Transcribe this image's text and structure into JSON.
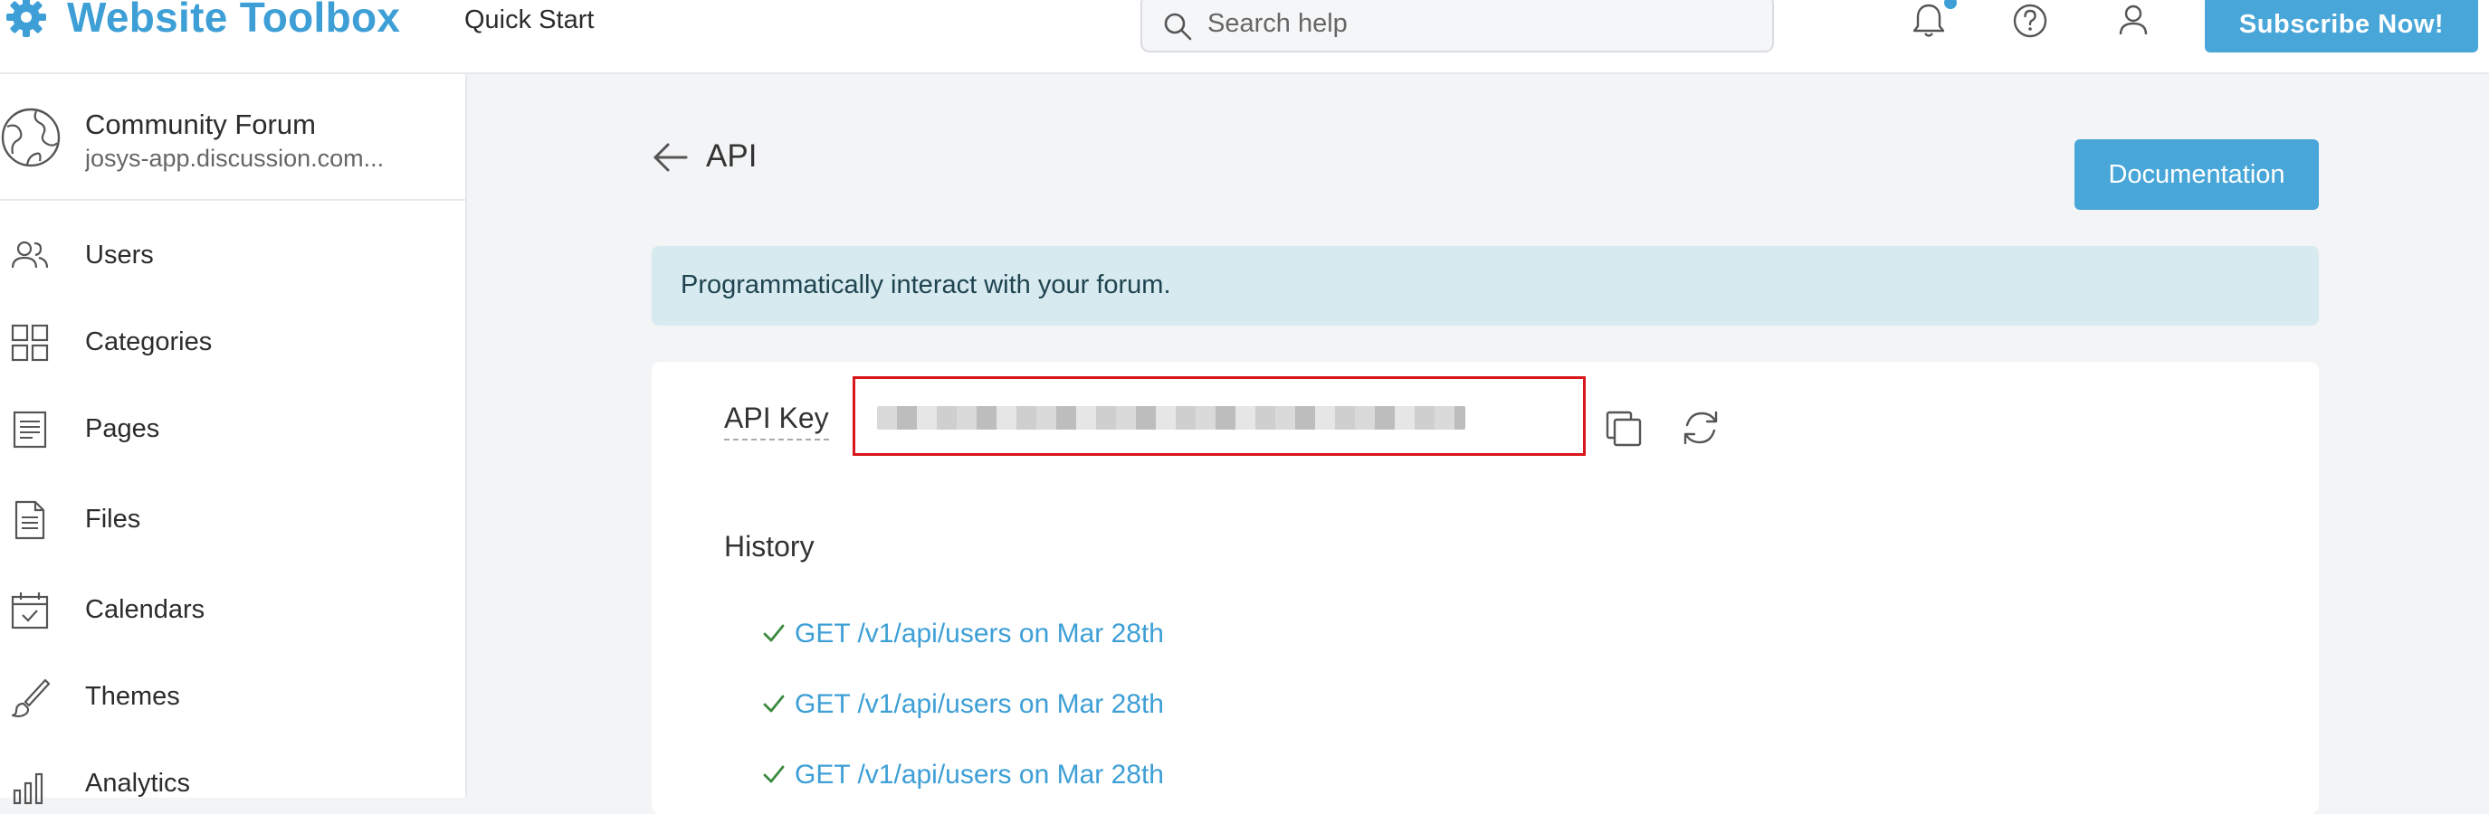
{
  "header": {
    "logo_text": "Website Toolbox",
    "quick_start": "Quick Start",
    "search_placeholder": "Search help",
    "subscribe_label": "Subscribe Now!"
  },
  "sidebar": {
    "site_name": "Community Forum",
    "site_url": "josys-app.discussion.com...",
    "items": [
      {
        "label": "Users",
        "icon": "users-icon"
      },
      {
        "label": "Categories",
        "icon": "categories-icon"
      },
      {
        "label": "Pages",
        "icon": "pages-icon"
      },
      {
        "label": "Files",
        "icon": "files-icon"
      },
      {
        "label": "Calendars",
        "icon": "calendar-icon"
      },
      {
        "label": "Themes",
        "icon": "brush-icon"
      },
      {
        "label": "Analytics",
        "icon": "analytics-icon"
      }
    ]
  },
  "main": {
    "title": "API",
    "documentation_label": "Documentation",
    "info_text": "Programmatically interact with your forum.",
    "api_key_label": "API Key",
    "api_key_value": "••••••••••••••••••••••••••••••",
    "history_title": "History",
    "history": [
      {
        "text": "GET /v1/api/users on Mar 28th"
      },
      {
        "text": "GET /v1/api/users on Mar 28th"
      },
      {
        "text": "GET /v1/api/users on Mar 28th"
      }
    ]
  },
  "colors": {
    "brand": "#3d9fd6",
    "button": "#48a6d8",
    "banner": "#d6eaf0",
    "highlight_border": "#d9161c",
    "check": "#3b8a3e"
  }
}
